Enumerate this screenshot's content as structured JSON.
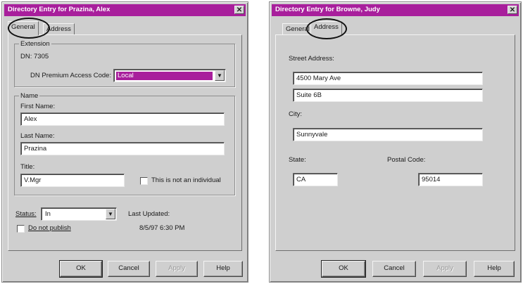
{
  "left_dialog": {
    "title": "Directory Entry for Prazina, Alex",
    "close_glyph": "✕",
    "tabs": [
      "General",
      "Address"
    ],
    "extension": {
      "group_label": "Extension",
      "dn_label": "DN: 7305",
      "premium_access_label": "DN Premium Access Code:",
      "premium_access_value": "Local"
    },
    "name": {
      "group_label": "Name",
      "first_name_label": "First Name:",
      "first_name_value": "Alex",
      "last_name_label": "Last Name:",
      "last_name_value": "Prazina",
      "title_label": "Title:",
      "title_value": "V.Mgr",
      "not_individual_label": "This is not an individual"
    },
    "status_label": "Status:",
    "status_value": "In",
    "last_updated_label": "Last Updated:",
    "last_updated_value": "8/5/97 6:30 PM",
    "do_not_publish_label": "Do not publish",
    "buttons": {
      "ok": "OK",
      "cancel": "Cancel",
      "apply": "Apply",
      "help": "Help"
    }
  },
  "right_dialog": {
    "title": "Directory Entry for Browne, Judy",
    "close_glyph": "✕",
    "tabs": [
      "General",
      "Address"
    ],
    "street_address_label": "Street Address:",
    "street_line1": "4500 Mary Ave",
    "street_line2": "Suite 6B",
    "city_label": "City:",
    "city_value": "Sunnyvale",
    "state_label": "State:",
    "state_value": "CA",
    "postal_code_label": "Postal Code:",
    "postal_code_value": "95014",
    "buttons": {
      "ok": "OK",
      "cancel": "Cancel",
      "apply": "Apply",
      "help": "Help"
    }
  },
  "colors": {
    "titlebar": "#a81f9c",
    "dialog_face": "#cfcfcf",
    "selection": "#a81f9c"
  },
  "icons": {
    "combo_arrow": "▼"
  }
}
